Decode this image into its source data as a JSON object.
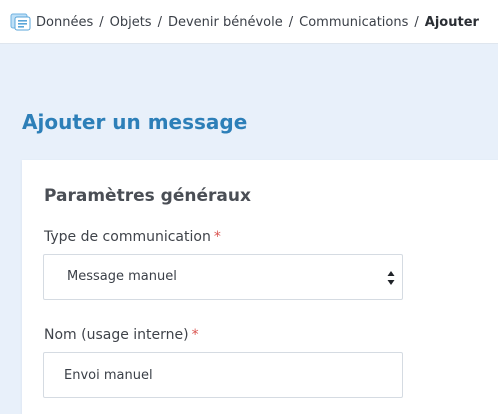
{
  "breadcrumb": {
    "icon": "folder-icon",
    "items": [
      "Données",
      "Objets",
      "Devenir bénévole",
      "Communications"
    ],
    "current": "Ajouter",
    "separator": "/"
  },
  "page": {
    "title": "Ajouter un message"
  },
  "form": {
    "section_title": "Paramètres généraux",
    "communication_type": {
      "label": "Type de communication",
      "required_mark": "*",
      "selected": "Message manuel"
    },
    "internal_name": {
      "label": "Nom (usage interne)",
      "required_mark": "*",
      "value": "Envoi manuel"
    }
  },
  "colors": {
    "accent": "#2d7fb8",
    "required": "#d9534f",
    "background": "#e8f0fa"
  }
}
